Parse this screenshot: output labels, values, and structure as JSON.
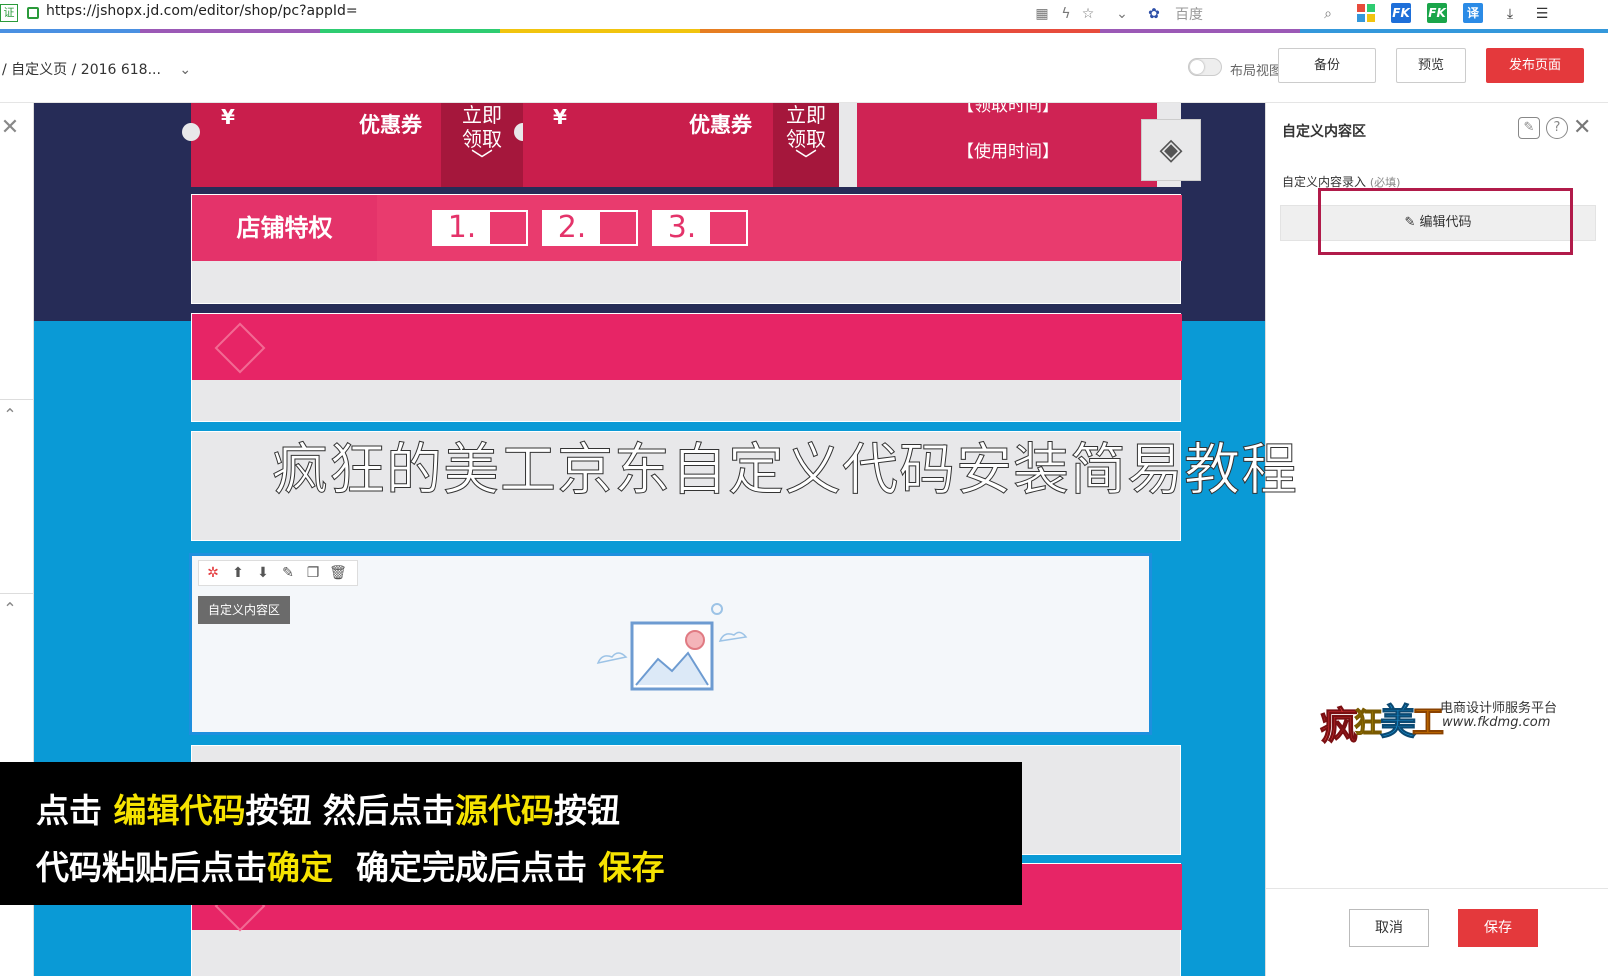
{
  "browser": {
    "cert_badge": "证",
    "url": "https://jshopx.jd.com/editor/shop/pc?appId=",
    "search_engine": "百度",
    "fk_badge": "FK",
    "translate_badge": "译"
  },
  "header": {
    "breadcrumb": "/  自定义页  /  2016 618...",
    "layout_toggle_label": "布局视图",
    "backup_label": "备份",
    "preview_label": "预览",
    "publish_label": "发布页面"
  },
  "canvas": {
    "coupon_yen": "¥",
    "coupon_title": "优惠券",
    "coupon_get_line1": "立即",
    "coupon_get_line2": "领取",
    "coupon3_line1": "【领取时间】",
    "coupon3_line2": "【使用时间】",
    "privilege_label": "店铺特权",
    "privilege_items": [
      "1.",
      "2.",
      "3."
    ],
    "overlay_title": "疯狂的美工京东自定义代码安装简易教程",
    "selected_module_tag": "自定义内容区"
  },
  "right_panel": {
    "title": "自定义内容区",
    "field_label": "自定义内容录入",
    "field_required": "(必填)",
    "edit_code_label": "编辑代码",
    "cancel_label": "取消",
    "save_label": "保存"
  },
  "logo": {
    "name": "疯狂美工",
    "tagline": "电商设计师服务平台",
    "url": "www.fkdmg.com"
  },
  "caption": {
    "line1_parts": [
      "点击 ",
      "编辑代码",
      "按钮 然后点击",
      "源代码",
      "按钮"
    ],
    "line2_parts": [
      "代码粘贴后点击",
      "确定",
      "  确定完成后点击 ",
      "保存"
    ]
  },
  "colors": {
    "accent_red": "#e4393c",
    "canvas_blue": "#0a9ad6",
    "coupon_red": "#c91e4c",
    "privilege_pink": "#e93b6e",
    "caption_highlight": "#f6e300",
    "edit_highlight_border": "#b11b4a"
  }
}
